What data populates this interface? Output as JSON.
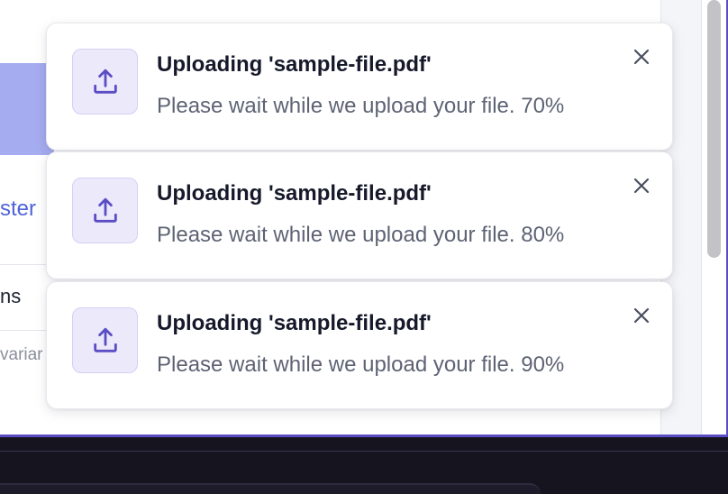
{
  "background": {
    "link_fragment": "ster",
    "heading_fragment": "ns",
    "subtext_fragment": "variar"
  },
  "toasts": [
    {
      "icon": "upload-icon",
      "title": "Uploading 'sample-file.pdf'",
      "message": "Please wait while we upload your file. 70%",
      "progress_percent": 70,
      "close_icon": "close-icon"
    },
    {
      "icon": "upload-icon",
      "title": "Uploading 'sample-file.pdf'",
      "message": "Please wait while we upload your file. 80%",
      "progress_percent": 80,
      "close_icon": "close-icon"
    },
    {
      "icon": "upload-icon",
      "title": "Uploading 'sample-file.pdf'",
      "message": "Please wait while we upload your file. 90%",
      "progress_percent": 90,
      "close_icon": "close-icon"
    }
  ],
  "colors": {
    "accent": "#4f63d8",
    "icon_background": "#ece9fb",
    "icon_stroke": "#5b4dc4",
    "window_border": "#5b4dc4"
  }
}
